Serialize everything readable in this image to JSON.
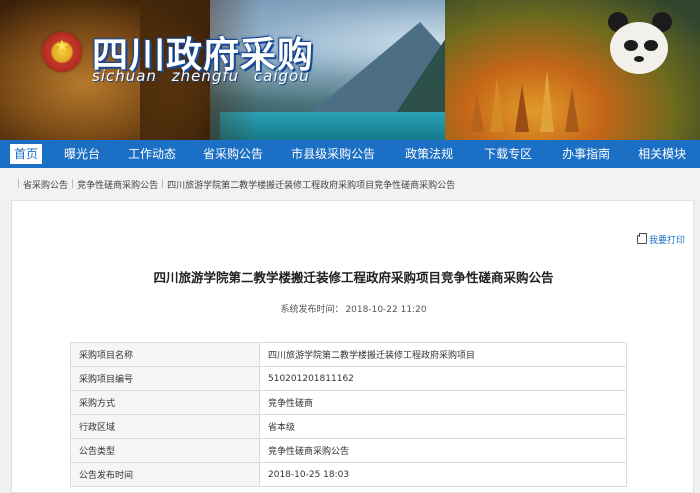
{
  "site": {
    "title": "四川政府采购",
    "subtitle": "sichuan zhengfu caigou"
  },
  "nav": {
    "items": [
      "首页",
      "曝光台",
      "工作动态",
      "省采购公告",
      "市县级采购公告",
      "政策法规",
      "下载专区",
      "办事指南",
      "相关模块"
    ],
    "active_index": 0
  },
  "breadcrumb": [
    "省采购公告",
    "竞争性磋商采购公告",
    "四川旅游学院第二教学楼搬迁装修工程政府采购项目竞争性磋商采购公告"
  ],
  "article": {
    "print_label": "我要打印",
    "title": "四川旅游学院第二教学楼搬迁装修工程政府采购项目竞争性磋商采购公告",
    "pubtime_label": "系统发布时间：",
    "pubtime_value": "2018-10-22 11:20"
  },
  "info_table": [
    {
      "key": "采购项目名称",
      "value": "四川旅游学院第二教学楼搬迁装修工程政府采购项目"
    },
    {
      "key": "采购项目编号",
      "value": "510201201811162"
    },
    {
      "key": "采购方式",
      "value": "竞争性磋商"
    },
    {
      "key": "行政区域",
      "value": "省本级"
    },
    {
      "key": "公告类型",
      "value": "竞争性磋商采购公告"
    },
    {
      "key": "公告发布时间",
      "value": "2018-10-25 18:03"
    }
  ],
  "colors": {
    "nav_bg": "#1b6fc4",
    "link": "#1b6fc4"
  }
}
